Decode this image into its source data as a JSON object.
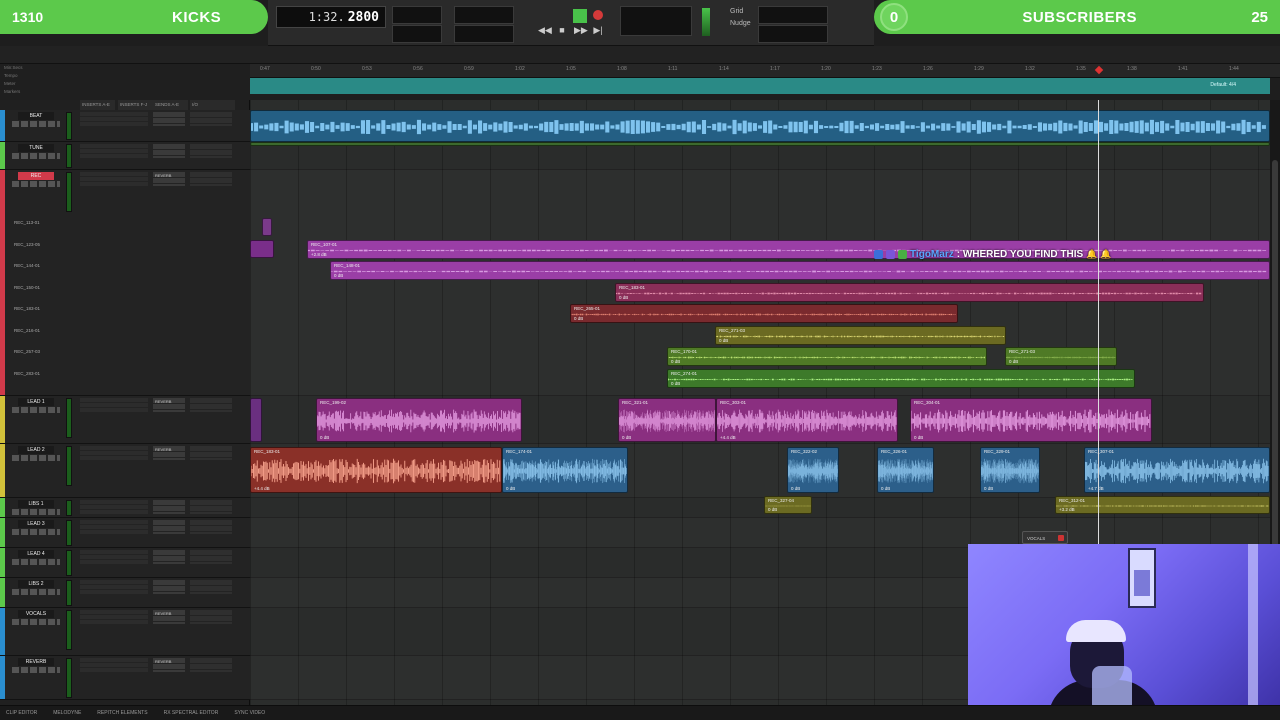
{
  "overlay": {
    "kicks_count": "1310",
    "kicks_label": "KICKS",
    "subscribers_count": "0",
    "subscribers_label": "SUBSCRIBERS",
    "subscribers_goal": "25",
    "accent_color": "#5cc94b"
  },
  "toolbar": {
    "counter_time": "1:32.",
    "counter_samples": "2800",
    "grid_label": "Grid",
    "nudge_label": "Nudge"
  },
  "rulers": [
    "Min:Secs",
    "Tempo",
    "Meter",
    "Markers"
  ],
  "ruler_ticks": [
    "0:47",
    "0:50",
    "0:53",
    "0:56",
    "0:59",
    "1:02",
    "1:05",
    "1:08",
    "1:11",
    "1:14",
    "1:17",
    "1:20",
    "1:23",
    "1:26",
    "1:29",
    "1:32",
    "1:35",
    "1:38",
    "1:41",
    "1:44"
  ],
  "marker_label": "Default: 4/4",
  "columns": [
    "INSERTS A-E",
    "INSERTS F-J",
    "SENDS A-E",
    "I/O"
  ],
  "tracks": [
    {
      "name": "BEAT",
      "color": "#2a8ecf",
      "send": ""
    },
    {
      "name": "TUNE",
      "color": "#5cc94b",
      "send": ""
    },
    {
      "name": "REC",
      "color": "#d13a4a",
      "send": "REVERB"
    },
    {
      "name": "LEAD 1",
      "color": "#d1c03a",
      "send": "REVERB"
    },
    {
      "name": "LEAD 2",
      "color": "#d1c03a",
      "send": "REVERB"
    },
    {
      "name": "LIBS 1",
      "color": "#5cc94b",
      "send": ""
    },
    {
      "name": "LEAD 3",
      "color": "#5cc94b",
      "send": ""
    },
    {
      "name": "LEAD 4",
      "color": "#5cc94b",
      "send": ""
    },
    {
      "name": "LIBS 2",
      "color": "#5cc94b",
      "send": ""
    },
    {
      "name": "VOCALS",
      "color": "#2a8ecf",
      "send": "REVERB"
    },
    {
      "name": "REVERB",
      "color": "#2a8ecf",
      "send": "REVERB"
    }
  ],
  "rec_lanes": [
    "REC_113-01",
    "REC_123-05",
    "REC_144-01",
    "REC_150-01",
    "REC_183-01",
    "REC_216-01",
    "REC_257-03",
    "REC_283-01"
  ],
  "clips": [
    {
      "name": "REC_107-01",
      "gain": "+2.8 dB",
      "color": "#9a3ea6"
    },
    {
      "name": "REC_148-01",
      "gain": "0 dB",
      "color": "#9a3ea6"
    },
    {
      "name": "REC_183-01",
      "gain": "0 dB",
      "color": "#8a2e58"
    },
    {
      "name": "REC_265-01",
      "gain": "0 dB",
      "color": "#7a2a2e"
    },
    {
      "name": "REC_271-03",
      "gain": "0 dB",
      "color": "#6b6a22"
    },
    {
      "name": "REC_170-01",
      "gain": "0 dB",
      "color": "#4f7a26"
    },
    {
      "name": "REC_271-03",
      "gain": "0 dB",
      "color": "#4f7a26"
    },
    {
      "name": "REC_274-01",
      "gain": "0 dB",
      "color": "#3d7a2a"
    },
    {
      "name": "REC_199-02",
      "gain": "0 dB",
      "color": "#8a2f80"
    },
    {
      "name": "REC_321-01",
      "gain": "0 dB",
      "color": "#8a2f80"
    },
    {
      "name": "REC_303-01",
      "gain": "+4.4 dB",
      "color": "#8a2f80"
    },
    {
      "name": "REC_304-01",
      "gain": "0 dB",
      "color": "#8a2f80"
    },
    {
      "name": "REC_183-01",
      "gain": "+4.4 dB",
      "color": "#8a3028"
    },
    {
      "name": "REC_174-01",
      "gain": "0 dB",
      "color": "#2c5f8a"
    },
    {
      "name": "REC_322-02",
      "gain": "0 dB",
      "color": "#2c5f8a"
    },
    {
      "name": "REC_326-01",
      "gain": "0 dB",
      "color": "#2c5f8a"
    },
    {
      "name": "REC_329-01",
      "gain": "0 dB",
      "color": "#2c5f8a"
    },
    {
      "name": "REC_307-01",
      "gain": "+4.7 dB",
      "color": "#2c5f8a"
    },
    {
      "name": "REC_327-04",
      "gain": "0 dB",
      "color": "#6b6a22"
    },
    {
      "name": "REC_312-01",
      "gain": "+3.2 dB",
      "color": "#6b6a22"
    }
  ],
  "chat": {
    "username": "TigoMarz",
    "message": ": WHERED YOU FIND THIS"
  },
  "vocals_popup": "VOCALS",
  "status_tabs": [
    "CLIP EDITOR",
    "MELODYNE",
    "REPITCH ELEMENTS",
    "RX SPECTRAL EDITOR",
    "SYNC VIDEO"
  ]
}
